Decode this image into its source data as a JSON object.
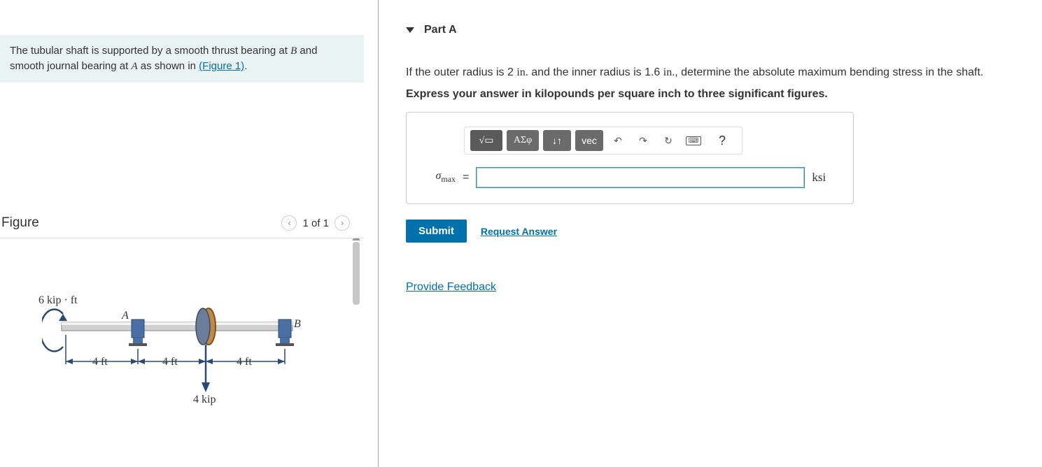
{
  "problem": {
    "text_before": "The tubular shaft is supported by a smooth thrust bearing at ",
    "var_B": "B",
    "text_mid": " and smooth journal bearing at ",
    "var_A": "A",
    "text_after": " as shown in ",
    "figlink": "(Figure 1)",
    "tail": "."
  },
  "figure": {
    "title": "Figure",
    "counter": "1 of 1",
    "labels": {
      "moment": "6 kip · ft",
      "A": "A",
      "B": "B",
      "span1": "4 ft",
      "span2": "4 ft",
      "span3": "4 ft",
      "load": "4 kip"
    }
  },
  "part": {
    "title": "Part A",
    "question_1": "If the outer radius is 2 ",
    "unit_in1": "in.",
    "question_2": " and the inner radius is 1.6 ",
    "unit_in2": "in.",
    "question_3": ", determine the absolute maximum bending stress in the shaft.",
    "instruction": "Express your answer in kilopounds per square inch to three significant figures."
  },
  "toolbar": {
    "sqrt": "√▭",
    "letters": "ΑΣφ",
    "updown": "↓↑",
    "vec": "vec",
    "undo": "↶",
    "redo": "↷",
    "refresh": "↻",
    "keyboard": "⌨",
    "help": "?"
  },
  "answer": {
    "sigma": "σ",
    "sub": "max",
    "eq": "=",
    "value": "",
    "placeholder": "",
    "unit": "ksi"
  },
  "actions": {
    "submit": "Submit",
    "request": "Request Answer"
  },
  "feedback": "Provide Feedback"
}
